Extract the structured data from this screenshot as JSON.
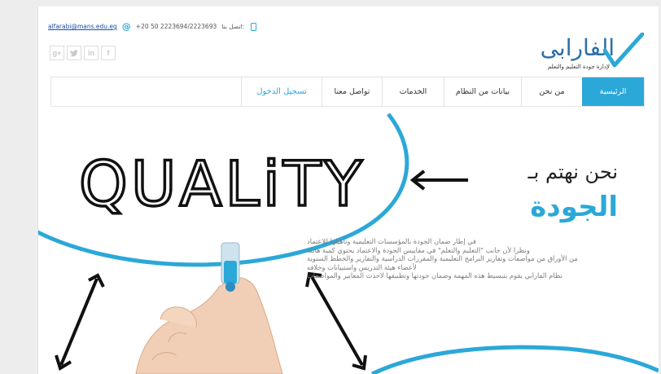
{
  "contact": {
    "email": "alfarabi@mans.edu.eg",
    "phone": "+20 50 2223694/2223693",
    "phone_label": "اتصل بنا:",
    "email_icon": "at-icon",
    "phone_icon": "mobile-phone-icon"
  },
  "social": [
    {
      "name": "google-plus-icon",
      "glyph": "g+"
    },
    {
      "name": "twitter-icon",
      "glyph": "✦"
    },
    {
      "name": "linkedin-icon",
      "glyph": "in"
    },
    {
      "name": "facebook-icon",
      "glyph": "f"
    }
  ],
  "logo": {
    "name": "الفارابى",
    "tagline": "لإدارة جودة التعليم والتعلم"
  },
  "nav": {
    "items": [
      "الرئيسية",
      "من نحن",
      "بيانات من النظام",
      "الخدمات",
      "تواصل معنا",
      "تسجيل الدخول"
    ]
  },
  "hero": {
    "image_text": "QUALiTY",
    "headline": "نحن نهتم بـ",
    "highlight": "الجودة",
    "paragraph": [
      "في إطار ضمان الجودة بالمؤسسات التعليمية وتأهيلها للاعتماد",
      "ونظرا لأن جانب \"التعليم والتعلم\" في مقاييس الجودة والاعتماد يحتوي كمية هائلة",
      "من الأوراق من مواصفات وتقارير البرامج التعليمية والمقررات الدراسية والتقارير والخطط السنوية",
      "لأعضاء هيئة التدريس واستبيانات وخلافه",
      "نظام الفارابي يقوم بتبسيط هذه المهمة وضمان جودتها وتطبيقها لاحدث المعايير والمواصفات"
    ]
  },
  "colors": {
    "accent": "#2ba8d8",
    "logo_blue": "#2c6fa8",
    "logo_check": "#2ba8d8"
  }
}
